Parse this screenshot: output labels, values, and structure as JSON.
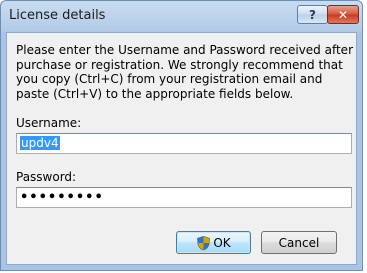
{
  "window": {
    "title": "License details",
    "help_label": "?",
    "close_label": "✕"
  },
  "description": "Please enter the Username and Password received after purchase or registration. We strongly recommend that you copy (Ctrl+C) from your registration email and paste (Ctrl+V) to the appropriate fields below.",
  "username": {
    "label": "Username:",
    "value": "updv4"
  },
  "password": {
    "label": "Password:",
    "value": "•••••••••"
  },
  "buttons": {
    "ok_label": "OK",
    "cancel_label": "Cancel"
  },
  "icons": {
    "ok_icon": "security-shield-icon"
  }
}
